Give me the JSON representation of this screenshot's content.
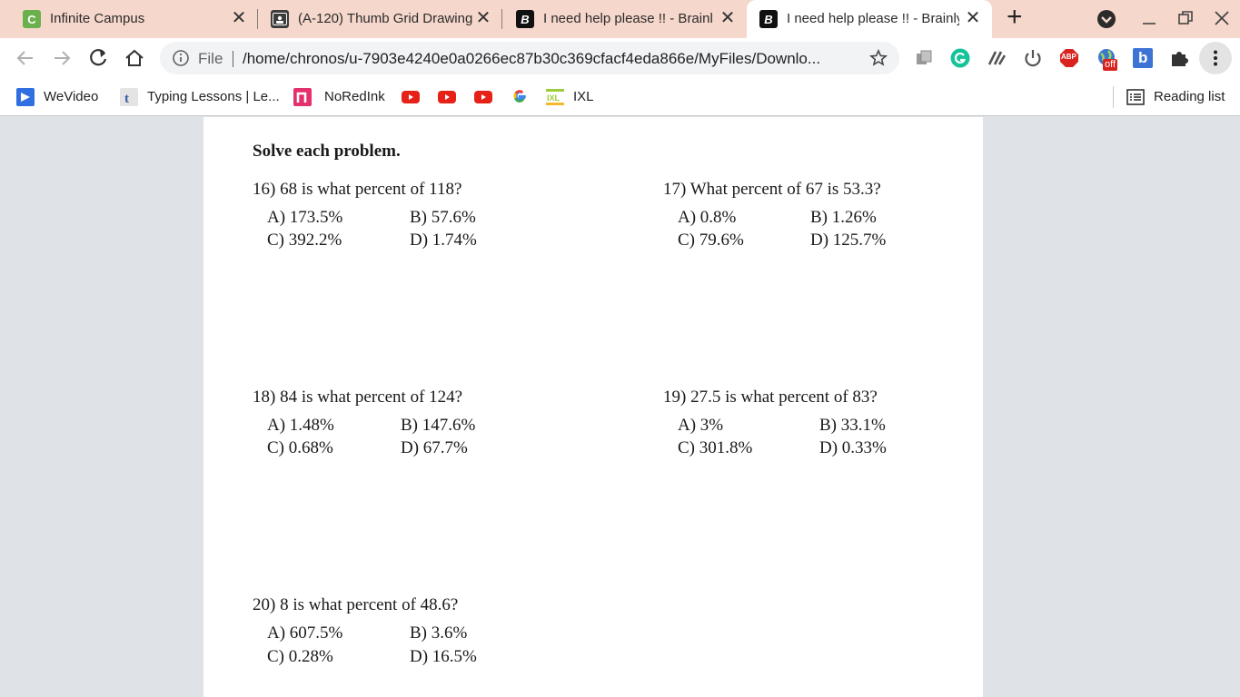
{
  "tabs": [
    {
      "title": "Infinite Campus",
      "favicon": "C"
    },
    {
      "title": "(A-120) Thumb Grid Drawing",
      "favicon": "classroom-icon"
    },
    {
      "title": "I need help please !! - Brainly",
      "favicon": "B"
    },
    {
      "title": "I need help please !! - Brainly",
      "favicon": "B"
    }
  ],
  "new_tab_symbol": "+",
  "address": {
    "scheme_label": "File",
    "url": "/home/chronos/u-7903e4240e0a0266ec87b30c369cfacf4eda866e/MyFiles/Downlo..."
  },
  "extensions": {
    "abp_label": "ABP",
    "off_badge": "off",
    "b_label": "b"
  },
  "bookmarks": [
    {
      "label": "WeVideo"
    },
    {
      "label": "Typing Lessons | Le..."
    },
    {
      "label": "NoRedInk"
    },
    {
      "label": "IXL"
    }
  ],
  "reading_list": "Reading list",
  "document": {
    "heading": "Solve each problem.",
    "problems": [
      {
        "question": "16)  68 is what percent of 118?",
        "A": "A)  173.5%",
        "B": "B)  57.6%",
        "C": "C)  392.2%",
        "D": "D)  1.74%"
      },
      {
        "question": "17)  What percent of 67 is 53.3?",
        "A": "A)  0.8%",
        "B": "B)  1.26%",
        "C": "C)  79.6%",
        "D": "D)  125.7%"
      },
      {
        "question": "18)  84 is what percent of 124?",
        "A": "A)  1.48%",
        "B": "B)  147.6%",
        "C": "C)  0.68%",
        "D": "D)  67.7%"
      },
      {
        "question": "19)  27.5 is what percent of 83?",
        "A": "A)  3%",
        "B": "B)  33.1%",
        "C": "C)  301.8%",
        "D": "D)  0.33%"
      },
      {
        "question": "20)  8 is what percent of 48.6?",
        "A": "A)  607.5%",
        "B": "B)  3.6%",
        "C": "C)  0.28%",
        "D": "D)  16.5%"
      }
    ]
  },
  "colors": {
    "tabstrip": "#f6d7cc",
    "page_bg": "#dfe3e8",
    "infinite_campus": "#6ab04c",
    "youtube": "#e62117",
    "noredink": "#e4306b"
  }
}
